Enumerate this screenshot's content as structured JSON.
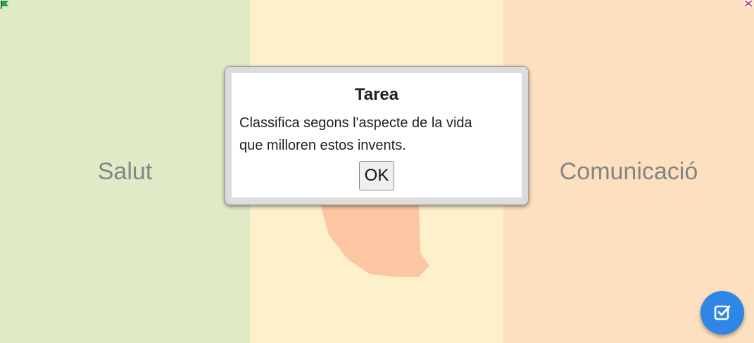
{
  "columns": {
    "left": {
      "label": "Salut",
      "color": "#dfebc6"
    },
    "middle": {
      "label": "",
      "color": "#fcf1cb"
    },
    "right": {
      "label": "Comunicació",
      "color": "#fde0bf"
    }
  },
  "dialog": {
    "title": "Tarea",
    "message_line1": "Classifica segons l'aspecte de la vida",
    "message_line2": "que milloren estos invents.",
    "ok_label": "OK"
  },
  "icons": {
    "top_left": "flag-icon",
    "top_right": "close-icon",
    "fab": "check-square-icon"
  },
  "accent_color": "#2e86e6"
}
